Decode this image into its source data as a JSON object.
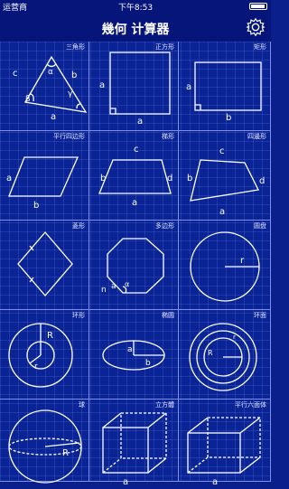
{
  "status": {
    "carrier": "运营商",
    "time": "下午8:53"
  },
  "nav": {
    "title": "幾何 计算器"
  },
  "shapes": [
    {
      "name": "三角形",
      "labels": [
        "c",
        "α",
        "b",
        "β",
        "γ",
        "a"
      ]
    },
    {
      "name": "正方形",
      "labels": [
        "a",
        "a"
      ]
    },
    {
      "name": "矩形",
      "labels": [
        "a",
        "b"
      ]
    },
    {
      "name": "平行四边形",
      "labels": [
        "a",
        "b"
      ]
    },
    {
      "name": "梯形",
      "labels": [
        "c",
        "b",
        "d",
        "a"
      ]
    },
    {
      "name": "四邊形",
      "labels": [
        "c",
        "b",
        "d",
        "a"
      ]
    },
    {
      "name": "菱形",
      "labels": []
    },
    {
      "name": "多边形",
      "labels": [
        "n",
        "a",
        "α"
      ]
    },
    {
      "name": "圆盘",
      "labels": [
        "r"
      ]
    },
    {
      "name": "环形",
      "labels": [
        "R",
        "r"
      ]
    },
    {
      "name": "椭圆",
      "labels": [
        "a",
        "b"
      ]
    },
    {
      "name": "环面",
      "labels": [
        "r",
        "R"
      ]
    },
    {
      "name": "球",
      "labels": [
        "R"
      ]
    },
    {
      "name": "立方體",
      "labels": [
        "a"
      ]
    },
    {
      "name": "平行六面体",
      "labels": [
        "a"
      ]
    }
  ]
}
